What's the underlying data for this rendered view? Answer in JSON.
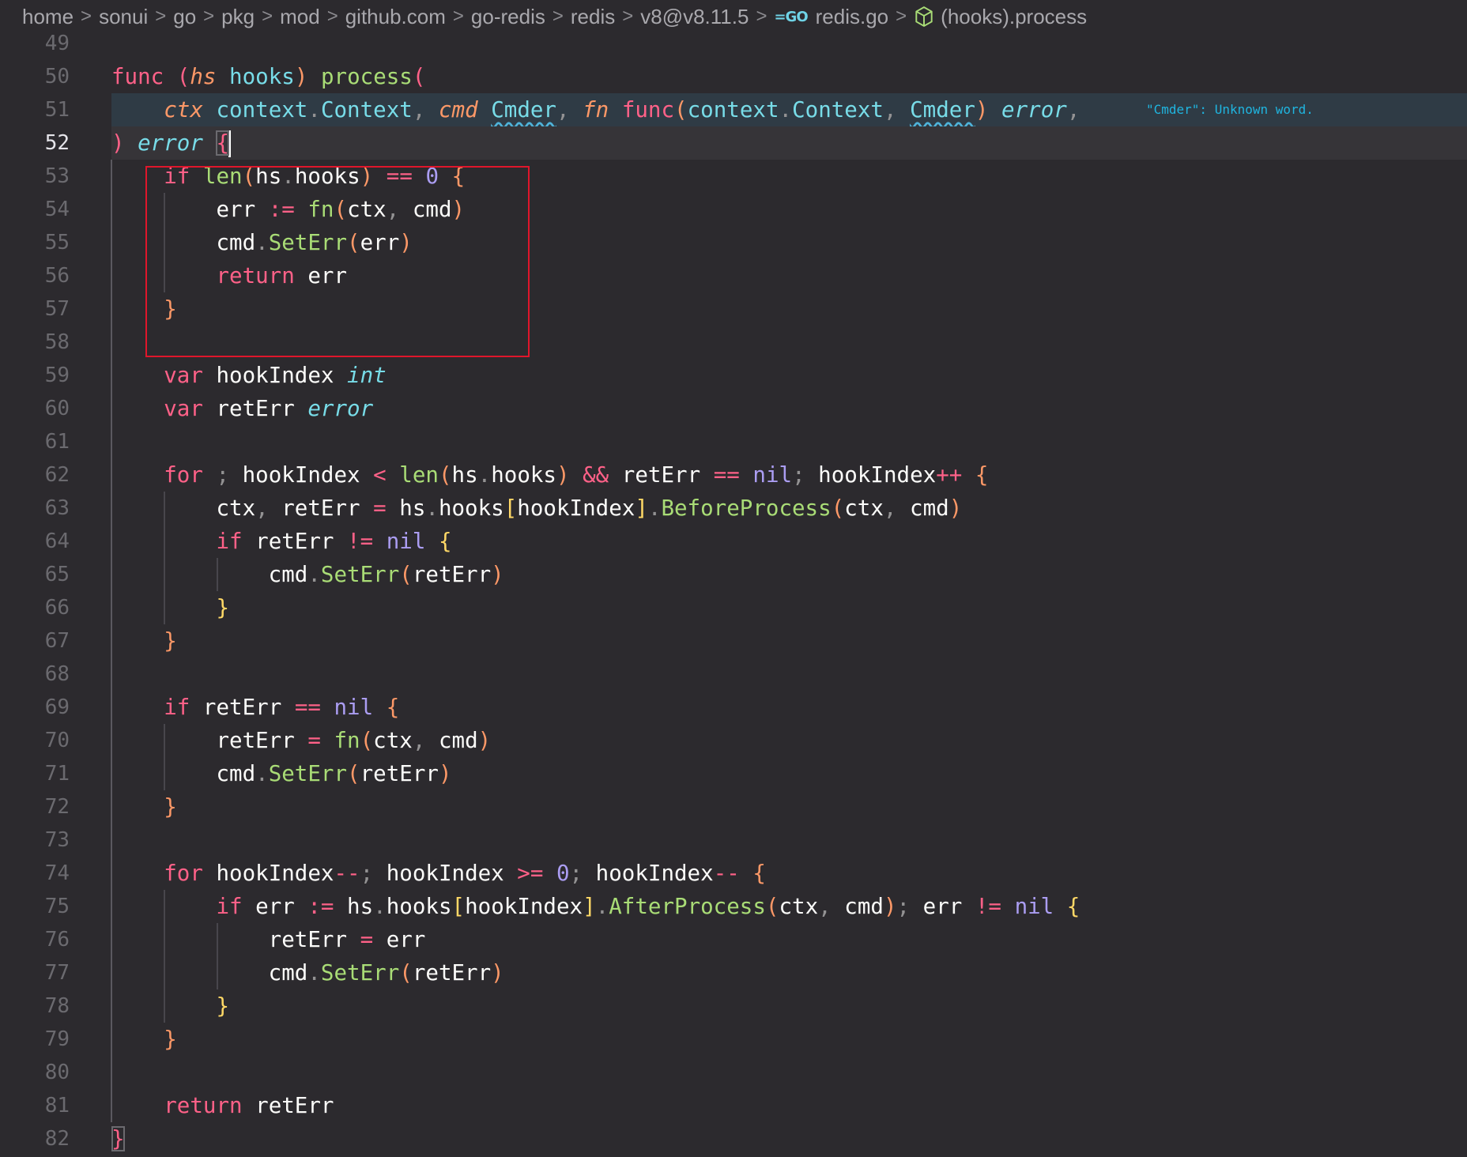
{
  "breadcrumb": {
    "items": [
      "home",
      "sonui",
      "go",
      "pkg",
      "mod",
      "github.com",
      "go-redis",
      "redis",
      "v8@v8.11.5"
    ],
    "file": {
      "icon": "go-file-icon",
      "icon_text": "=GO",
      "label": "redis.go"
    },
    "symbol": {
      "icon": "method-box-icon",
      "label": "(hooks).process"
    },
    "separator": ">"
  },
  "editor": {
    "language": "go",
    "active_line": 52,
    "highlighted_line": 51,
    "diagnostic": {
      "line": 51,
      "word": "Cmder",
      "message": "\"Cmder\": Unknown word."
    },
    "annotation_box": {
      "from_line": 53,
      "to_line": 57,
      "color": "#e0162b"
    },
    "colors": {
      "background": "#2c2a2e",
      "keyword": "#ff6188",
      "function": "#a9dc76",
      "type": "#78dce8",
      "parameter": "#fc9867",
      "number": "#ab9df2",
      "diagnostic": "#1fb5e0"
    },
    "lines": [
      {
        "n": 49,
        "text": ""
      },
      {
        "n": 50,
        "text": "func (hs hooks) process("
      },
      {
        "n": 51,
        "text": "    ctx context.Context, cmd Cmder, fn func(context.Context, Cmder) error,"
      },
      {
        "n": 52,
        "text": ") error {"
      },
      {
        "n": 53,
        "text": "    if len(hs.hooks) == 0 {"
      },
      {
        "n": 54,
        "text": "        err := fn(ctx, cmd)"
      },
      {
        "n": 55,
        "text": "        cmd.SetErr(err)"
      },
      {
        "n": 56,
        "text": "        return err"
      },
      {
        "n": 57,
        "text": "    }"
      },
      {
        "n": 58,
        "text": ""
      },
      {
        "n": 59,
        "text": "    var hookIndex int"
      },
      {
        "n": 60,
        "text": "    var retErr error"
      },
      {
        "n": 61,
        "text": ""
      },
      {
        "n": 62,
        "text": "    for ; hookIndex < len(hs.hooks) && retErr == nil; hookIndex++ {"
      },
      {
        "n": 63,
        "text": "        ctx, retErr = hs.hooks[hookIndex].BeforeProcess(ctx, cmd)"
      },
      {
        "n": 64,
        "text": "        if retErr != nil {"
      },
      {
        "n": 65,
        "text": "            cmd.SetErr(retErr)"
      },
      {
        "n": 66,
        "text": "        }"
      },
      {
        "n": 67,
        "text": "    }"
      },
      {
        "n": 68,
        "text": ""
      },
      {
        "n": 69,
        "text": "    if retErr == nil {"
      },
      {
        "n": 70,
        "text": "        retErr = fn(ctx, cmd)"
      },
      {
        "n": 71,
        "text": "        cmd.SetErr(retErr)"
      },
      {
        "n": 72,
        "text": "    }"
      },
      {
        "n": 73,
        "text": ""
      },
      {
        "n": 74,
        "text": "    for hookIndex--; hookIndex >= 0; hookIndex-- {"
      },
      {
        "n": 75,
        "text": "        if err := hs.hooks[hookIndex].AfterProcess(ctx, cmd); err != nil {"
      },
      {
        "n": 76,
        "text": "            retErr = err"
      },
      {
        "n": 77,
        "text": "            cmd.SetErr(retErr)"
      },
      {
        "n": 78,
        "text": "        }"
      },
      {
        "n": 79,
        "text": "    }"
      },
      {
        "n": 80,
        "text": ""
      },
      {
        "n": 81,
        "text": "    return retErr"
      },
      {
        "n": 82,
        "text": "}"
      }
    ]
  }
}
